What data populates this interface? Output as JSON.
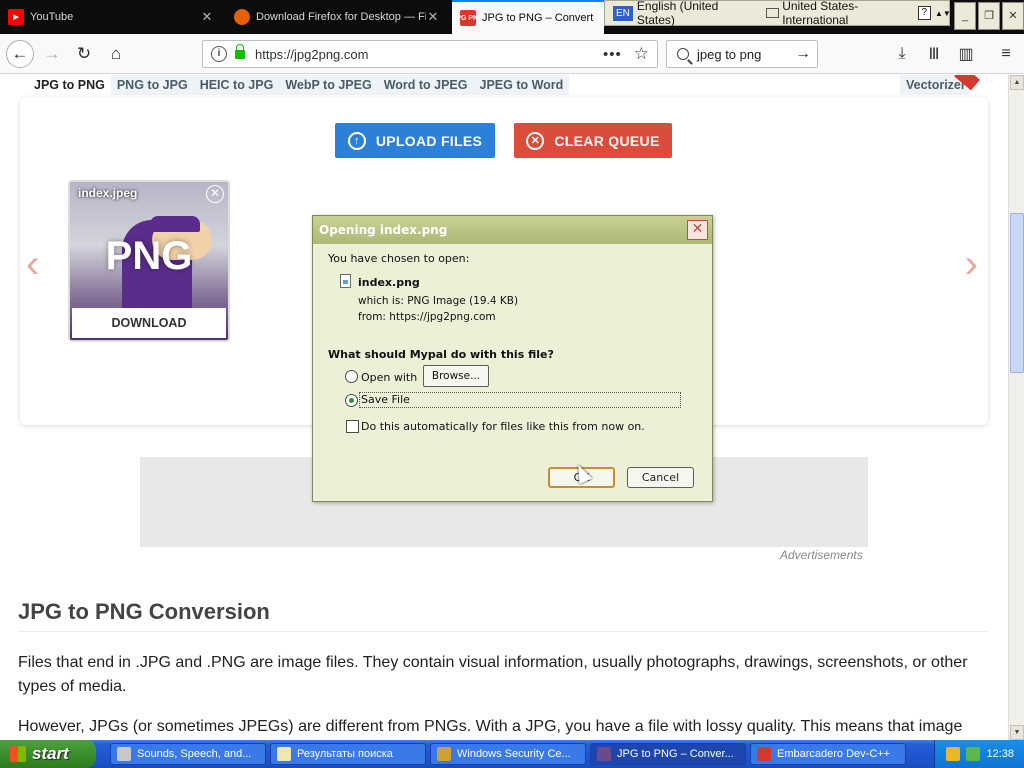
{
  "tabs": [
    {
      "title": "YouTube",
      "icon": "youtube-icon",
      "color": "#ff0000"
    },
    {
      "title": "Download Firefox for Desktop — Fi",
      "icon": "firefox-icon",
      "color": "#e66000"
    },
    {
      "title": "JPG to PNG – Convert JPEG",
      "icon": "jpg2png-icon",
      "color": "#d9372c",
      "fav_text": "JPG PNG"
    }
  ],
  "language_bar": {
    "lang_code": "EN",
    "language": "English (United States)",
    "keyboard": "United States-International",
    "help": "?"
  },
  "window_controls": {
    "minimize": "_",
    "restore": "❐",
    "close": "✕"
  },
  "nav": {
    "url": "https://jpg2png.com",
    "search_query": "jpeg to png",
    "info": "i",
    "dots": "•••",
    "star": "☆"
  },
  "site": {
    "tool_tabs": [
      "JPG to PNG",
      "PNG to JPG",
      "HEIC to JPG",
      "WebP to JPEG",
      "Word to JPEG",
      "JPEG to Word"
    ],
    "vectorizer": "Vectorizer",
    "upload_label": "UPLOAD FILES",
    "clear_label": "CLEAR QUEUE",
    "file": {
      "name": "index.jpeg",
      "format": "PNG",
      "download_label": "DOWNLOAD"
    },
    "ad_label": "Advertisements",
    "heading": "JPG to PNG Conversion",
    "paragraph1": "Files that end in .JPG and .PNG are image files. They contain visual information, usually photographs, drawings, screenshots, or other types of media.",
    "paragraph2": "However, JPGs (or sometimes JPEGs) are different from PNGs. With a JPG, you have a file with lossy quality. This means that image"
  },
  "dialog": {
    "title": "Opening index.png",
    "chosen_text": "You have chosen to open:",
    "file_name": "index.png",
    "which_is": "which is:  PNG Image (19.4 KB)",
    "from": "from:  https://jpg2png.com",
    "question": "What should Mypal do with this file?",
    "open_with": "Open with",
    "browse": "Browse...",
    "save_file": "Save File",
    "auto_label": "Do this automatically for files like this from now on.",
    "ok": "OK",
    "cancel": "Cancel",
    "close": "✕"
  },
  "taskbar": {
    "start": "start",
    "items": [
      {
        "label": "Sounds, Speech, and...",
        "color": "#c8c8c8"
      },
      {
        "label": "Результаты поиска",
        "color": "#f0e6b0"
      },
      {
        "label": "Windows Security Ce...",
        "color": "#d0a030"
      },
      {
        "label": "JPG to PNG – Conver...",
        "color": "#6a4a8a"
      },
      {
        "label": "Embarcadero Dev-C++",
        "color": "#d9372c"
      }
    ],
    "clock": "12:38"
  },
  "colors": {
    "upload": "#2d80d8",
    "clear": "#db4c3d",
    "active_tab_accent": "#0a84ff"
  }
}
